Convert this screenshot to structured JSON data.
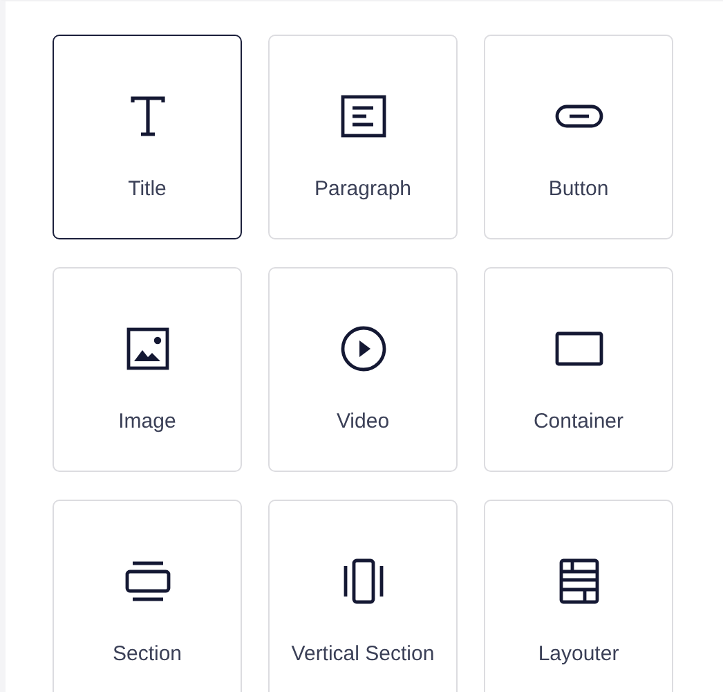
{
  "tiles": [
    {
      "kind": "title",
      "label": "Title",
      "selected": true
    },
    {
      "kind": "paragraph",
      "label": "Paragraph",
      "selected": false
    },
    {
      "kind": "button",
      "label": "Button",
      "selected": false
    },
    {
      "kind": "image",
      "label": "Image",
      "selected": false
    },
    {
      "kind": "video",
      "label": "Video",
      "selected": false
    },
    {
      "kind": "container",
      "label": "Container",
      "selected": false
    },
    {
      "kind": "section",
      "label": "Section",
      "selected": false
    },
    {
      "kind": "vertical-section",
      "label": "Vertical Section",
      "selected": false
    },
    {
      "kind": "layouter",
      "label": "Layouter",
      "selected": false
    }
  ]
}
